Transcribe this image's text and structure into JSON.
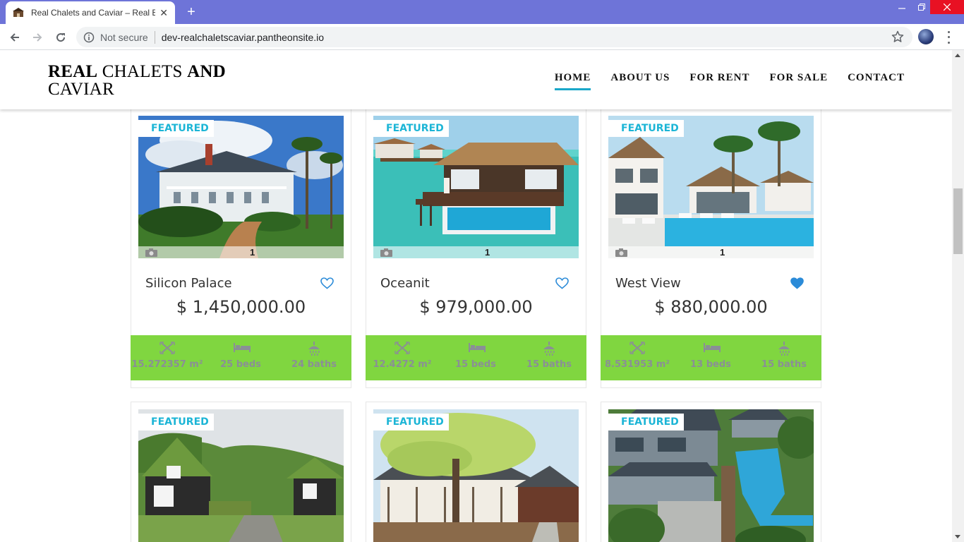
{
  "browser": {
    "tab_title": "Real Chalets and Caviar – Real Es",
    "security_label": "Not secure",
    "url": "dev-realchaletscaviar.pantheonsite.io"
  },
  "site": {
    "logo_bold_1": "REAL",
    "logo_regular_1": "CHALETS",
    "logo_bold_2": "AND",
    "logo_regular_2": "CAVIAR",
    "nav": [
      {
        "label": "HOME",
        "active": true
      },
      {
        "label": "ABOUT US"
      },
      {
        "label": "FOR RENT"
      },
      {
        "label": "FOR SALE"
      },
      {
        "label": "CONTACT"
      }
    ]
  },
  "listings": [
    {
      "badge": "FEATURED",
      "photos": "1",
      "name": "Silicon Palace",
      "price": "$ 1,450,000.00",
      "area": "15.272357 m²",
      "beds": "25 beds",
      "baths": "24 baths",
      "favorited": false,
      "scene": "mansion"
    },
    {
      "badge": "FEATURED",
      "photos": "1",
      "name": "Oceanit",
      "price": "$ 979,000.00",
      "area": "12.4272 m²",
      "beds": "15 beds",
      "baths": "15 baths",
      "favorited": false,
      "scene": "water-villa"
    },
    {
      "badge": "FEATURED",
      "photos": "1",
      "name": "West View",
      "price": "$ 880,000.00",
      "area": "8.531953 m²",
      "beds": "13 beds",
      "baths": "15 baths",
      "favorited": true,
      "scene": "pool-villa"
    },
    {
      "badge": "FEATURED",
      "scene": "turf-house"
    },
    {
      "badge": "FEATURED",
      "scene": "japanese-house"
    },
    {
      "badge": "FEATURED",
      "scene": "resort-aerial"
    }
  ],
  "colors": {
    "accent": "#1aa7c9",
    "featured_text": "#1cb5d6",
    "stats_bar": "#80d640",
    "heart": "#2b8bd8",
    "stat_text": "#8a8f96"
  },
  "icons": {
    "area": "area-icon",
    "beds": "bed-icon",
    "baths": "shower-icon",
    "photos": "camera-icon",
    "favorite": "heart-icon"
  }
}
